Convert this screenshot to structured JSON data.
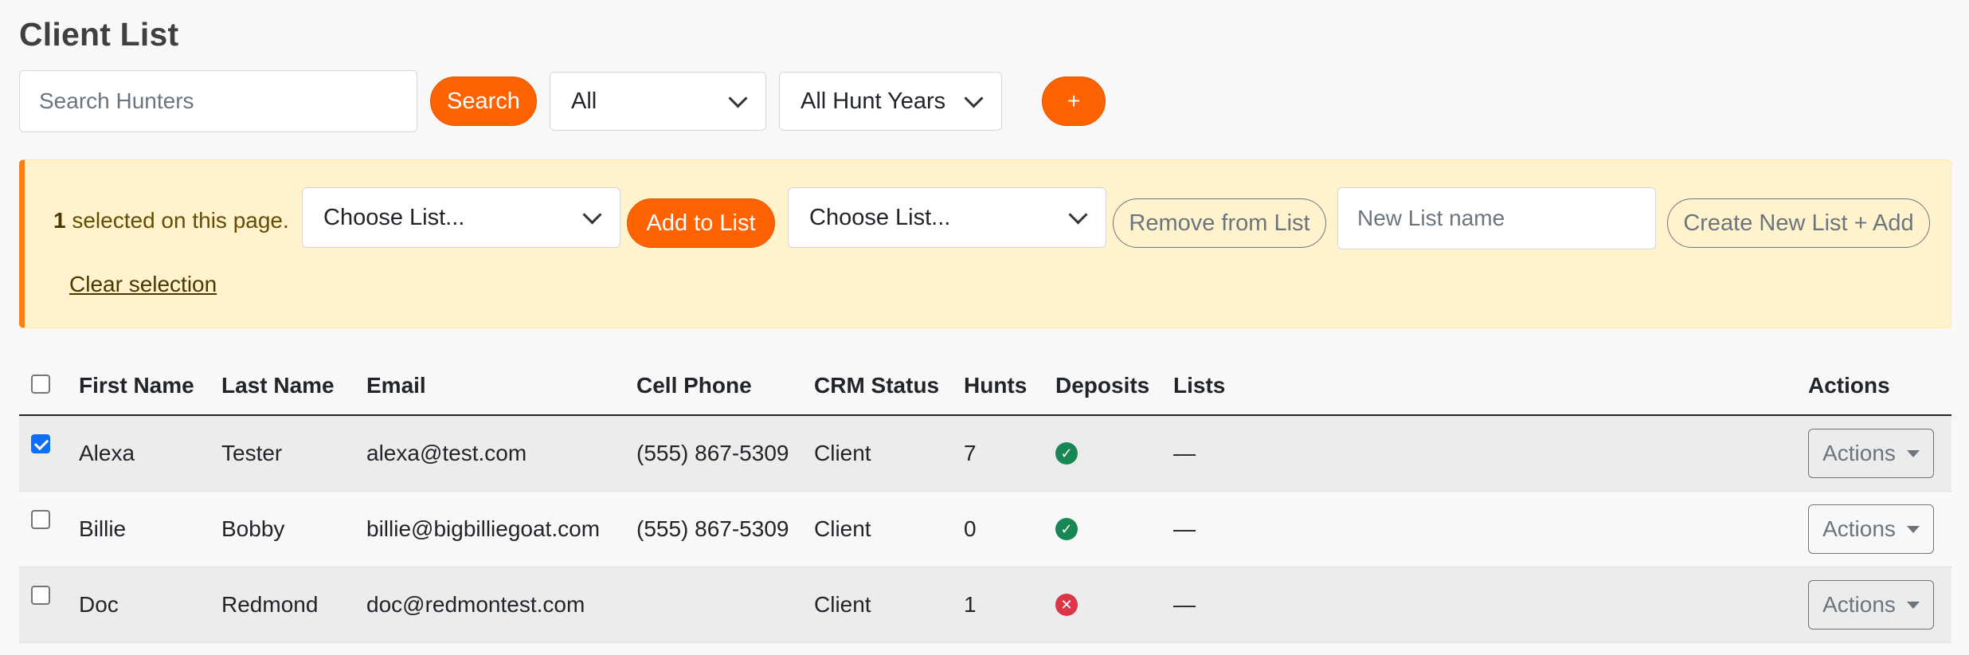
{
  "page": {
    "title": "Client List"
  },
  "toolbar": {
    "search_placeholder": "Search Hunters",
    "search_label": "Search",
    "type_filter": "All",
    "year_filter": "All Hunt Years",
    "add_label": "+"
  },
  "bulk": {
    "selected_count": "1",
    "selected_text": " selected on this page.",
    "choose_list_1": "Choose List...",
    "add_to_list_label": "Add to List",
    "choose_list_2": "Choose List...",
    "remove_label": "Remove from List",
    "new_list_placeholder": "New List name",
    "create_label": "Create New List + Add",
    "clear_label": "Clear selection"
  },
  "table": {
    "headers": [
      "First Name",
      "Last Name",
      "Email",
      "Cell Phone",
      "CRM Status",
      "Hunts",
      "Deposits",
      "Lists",
      "Actions"
    ],
    "actions_label": "Actions",
    "rows": [
      {
        "first": "Alexa",
        "last": "Tester",
        "email": "alexa@test.com",
        "phone": "(555) 867-5309",
        "status": "Client",
        "hunts": "7",
        "deposit": true,
        "lists": "—",
        "checked": true
      },
      {
        "first": "Billie",
        "last": "Bobby",
        "email": "billie@bigbilliegoat.com",
        "phone": "(555) 867-5309",
        "status": "Client",
        "hunts": "0",
        "deposit": true,
        "lists": "—",
        "checked": false
      },
      {
        "first": "Doc",
        "last": "Redmond",
        "email": "doc@redmontest.com",
        "phone": "",
        "status": "Client",
        "hunts": "1",
        "deposit": false,
        "lists": "—",
        "checked": false
      }
    ]
  },
  "colors": {
    "accent": "#ff6200",
    "alert_bg": "#fff3cd",
    "alert_border": "#fd7e14",
    "check_ok": "#198754",
    "check_no": "#dc3545"
  }
}
